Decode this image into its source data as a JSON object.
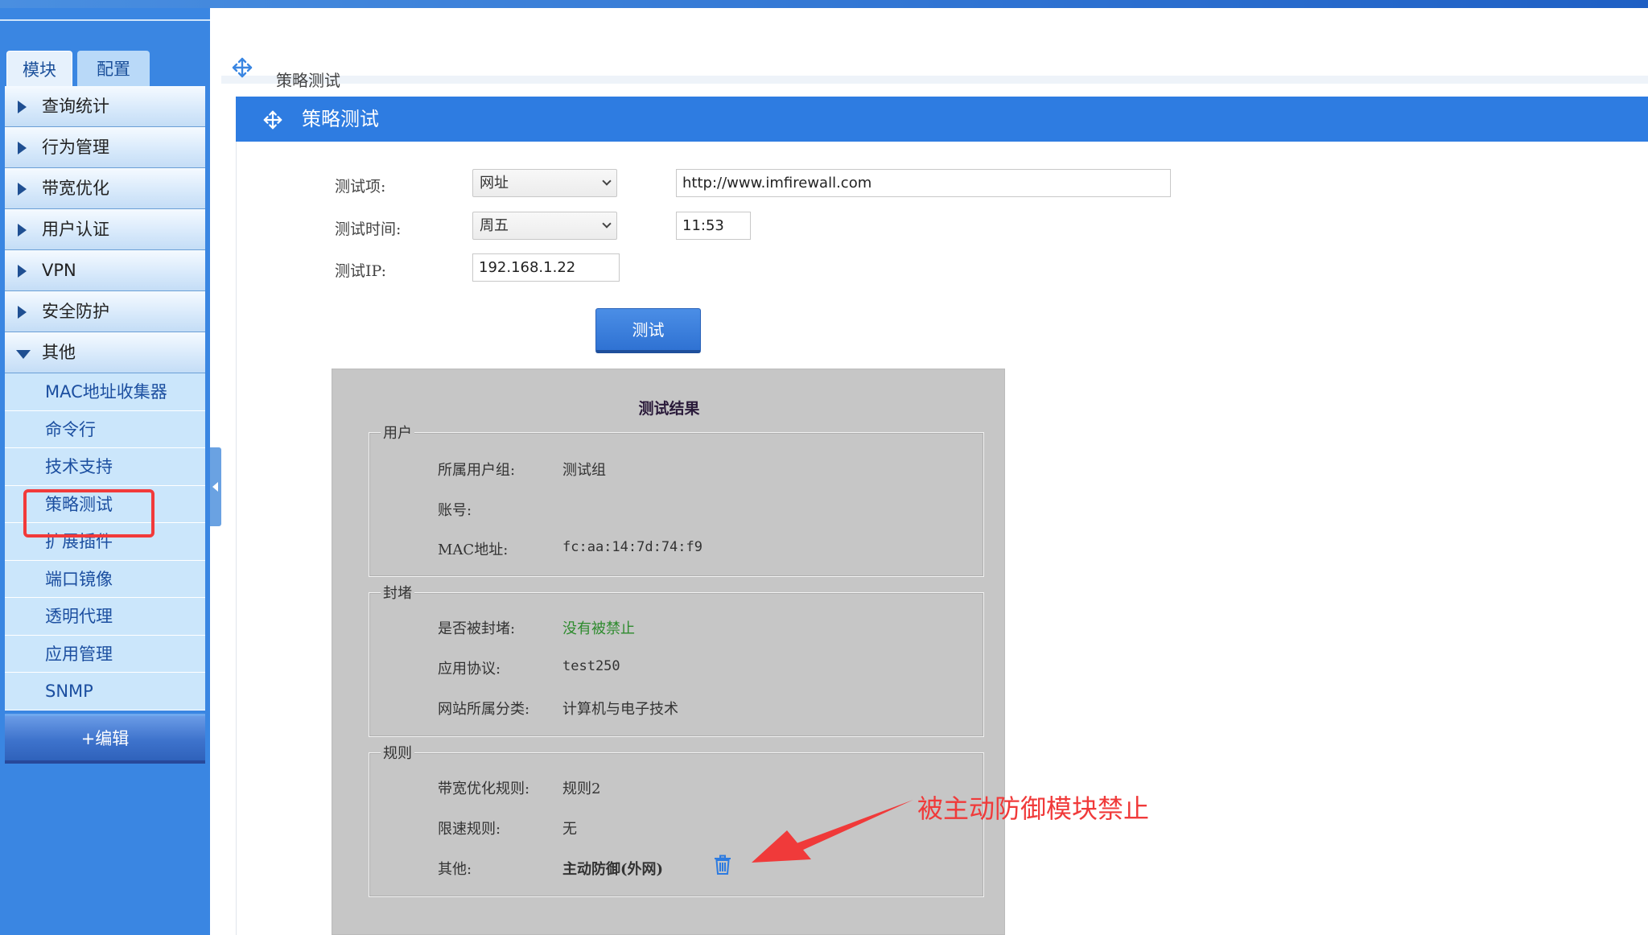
{
  "sidebar": {
    "tabs": {
      "module": "模块",
      "config": "配置"
    },
    "menu": [
      {
        "label": "查询统计"
      },
      {
        "label": "行为管理"
      },
      {
        "label": "带宽优化"
      },
      {
        "label": "用户认证"
      },
      {
        "label": "VPN"
      },
      {
        "label": "安全防护"
      },
      {
        "label": "其他"
      }
    ],
    "submenu": [
      {
        "label": "MAC地址收集器"
      },
      {
        "label": "命令行"
      },
      {
        "label": "技术支持"
      },
      {
        "label": "策略测试"
      },
      {
        "label": "扩展插件"
      },
      {
        "label": "端口镜像"
      },
      {
        "label": "透明代理"
      },
      {
        "label": "应用管理"
      },
      {
        "label": "SNMP"
      }
    ],
    "edit_label": "+编辑"
  },
  "breadcrumb": {
    "text": "策略测试"
  },
  "panel": {
    "title": "策略测试"
  },
  "form": {
    "test_item_label": "测试项:",
    "test_item_value": "网址",
    "url_value": "http://www.imfirewall.com",
    "test_time_label": "测试时间:",
    "test_day_value": "周五",
    "test_time_value": "11:53",
    "test_ip_label": "测试IP:",
    "test_ip_value": "192.168.1.22",
    "test_button": "测试"
  },
  "results": {
    "title": "测试结果",
    "user": {
      "legend": "用户",
      "group_label": "所属用户组:",
      "group_value": "测试组",
      "account_label": "账号:",
      "account_value": "",
      "mac_label": "MAC地址:",
      "mac_value": "fc:aa:14:7d:74:f9"
    },
    "block": {
      "legend": "封堵",
      "blocked_label": "是否被封堵:",
      "blocked_value": "没有被禁止",
      "protocol_label": "应用协议:",
      "protocol_value": "test250",
      "category_label": "网站所属分类:",
      "category_value": "计算机与电子技术"
    },
    "rules": {
      "legend": "规则",
      "bandwidth_label": "带宽优化规则:",
      "bandwidth_value": "规则2",
      "ratelimit_label": "限速规则:",
      "ratelimit_value": "无",
      "other_label": "其他:",
      "other_value": "主动防御(外网)"
    }
  },
  "annotation": {
    "text": "被主动防御模块禁止"
  },
  "colors": {
    "accent": "#2e7ce1",
    "sidebar": "#3a86e2",
    "annotation": "#f23a3a",
    "ok": "#2e8b2e"
  }
}
